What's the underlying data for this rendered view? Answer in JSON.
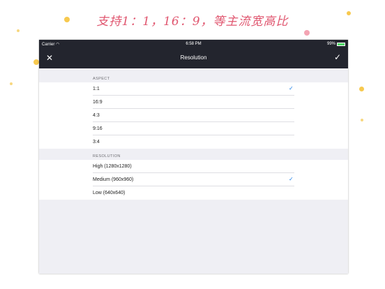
{
  "banner": {
    "text": "支持1：1，16：9，等主流宽高比"
  },
  "status_bar": {
    "carrier": "Carrier",
    "time": "6:58 PM",
    "battery": "99%",
    "battery_level": 0.99
  },
  "nav": {
    "title": "Resolution"
  },
  "sections": [
    {
      "header": "ASPECT",
      "items": [
        {
          "label": "1:1",
          "selected": true
        },
        {
          "label": "16:9",
          "selected": false
        },
        {
          "label": "4:3",
          "selected": false
        },
        {
          "label": "9:16",
          "selected": false
        },
        {
          "label": "3:4",
          "selected": false
        }
      ]
    },
    {
      "header": "RESOLUTION",
      "items": [
        {
          "label": "High (1280x1280)",
          "selected": false
        },
        {
          "label": "Medium (960x960)",
          "selected": true
        },
        {
          "label": "Low (640x640)",
          "selected": false
        }
      ]
    }
  ],
  "colors": {
    "nav_bg": "#23252e",
    "accent": "#1a7ee8",
    "banner": "#e0566f",
    "confetti": "#f7c94f"
  }
}
